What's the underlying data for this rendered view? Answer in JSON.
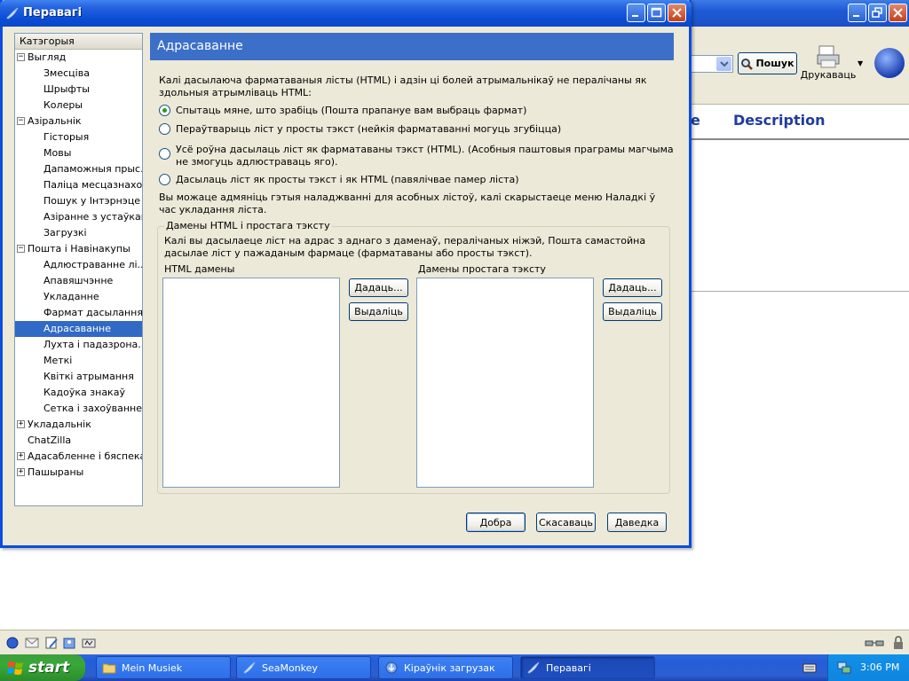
{
  "background_window": {
    "search_button": "Пошук",
    "print_label": "Друкаваць",
    "column_partial": "e",
    "column_description": "Description"
  },
  "dialog": {
    "title": "Перавагі",
    "category_header": "Катэгорыя",
    "tree": [
      {
        "label": "Выгляд",
        "level": 0,
        "twisty": "−"
      },
      {
        "label": "Змесціва",
        "level": 1
      },
      {
        "label": "Шрыфты",
        "level": 1
      },
      {
        "label": "Колеры",
        "level": 1
      },
      {
        "label": "Азіральнік",
        "level": 0,
        "twisty": "−"
      },
      {
        "label": "Гісторыя",
        "level": 1
      },
      {
        "label": "Мовы",
        "level": 1
      },
      {
        "label": "Дапаможныя прыс...",
        "level": 1
      },
      {
        "label": "Паліца месцазнахо...",
        "level": 1
      },
      {
        "label": "Пошук у Інтэрнэце",
        "level": 1
      },
      {
        "label": "Азіранне з устаўкамі",
        "level": 1
      },
      {
        "label": "Загрузкі",
        "level": 1
      },
      {
        "label": "Пошта і Навінакупы",
        "level": 0,
        "twisty": "−"
      },
      {
        "label": "Адлюстраванне лі...",
        "level": 1
      },
      {
        "label": "Апавяшчэнне",
        "level": 1
      },
      {
        "label": "Укладанне",
        "level": 1
      },
      {
        "label": "Фармат дасылання",
        "level": 1
      },
      {
        "label": "Адрасаванне",
        "level": 1,
        "selected": true
      },
      {
        "label": "Луxта і падазрона...",
        "level": 1
      },
      {
        "label": "Меткі",
        "level": 1
      },
      {
        "label": "Квіткі атрымання",
        "level": 1
      },
      {
        "label": "Кадоўка знакаў",
        "level": 1
      },
      {
        "label": "Сетка і захоўванне",
        "level": 1
      },
      {
        "label": "Укладальнік",
        "level": 0,
        "twisty": "+"
      },
      {
        "label": "ChatZilla",
        "level": 0
      },
      {
        "label": "Адасабленне і бяспека",
        "level": 0,
        "twisty": "+"
      },
      {
        "label": "Пашыраны",
        "level": 0,
        "twisty": "+"
      }
    ],
    "pane_title": "Адрасаванне",
    "intro": "Калі дасылаюча фарматаваныя лісты (HTML) і адзін ці болей атрымальнікаў не пералічаны як здольныя атрымліваць HTML:",
    "radios": [
      {
        "label": "Спытаць мяне, што зрабіць (Пошта прапануе вам выбраць фармат)",
        "checked": true
      },
      {
        "label": "Пераўтварыць ліст у просты тэкст (нейкія фарматаванні могуць згубіцца)",
        "checked": false
      },
      {
        "label": "Усё роўна дасылаць ліст як фарматаваны тэкст (HTML). (Асобныя паштовыя праграмы магчыма не змогуць адлюстраваць яго).",
        "checked": false
      },
      {
        "label": "Дасылаць ліст як просты тэкст і як HTML (павялічвае памер ліста)",
        "checked": false
      }
    ],
    "note": "Вы можаце адмяніць гэтыя наладжванні для асобных лістоў, калі скарыстаеце меню Наладкі ў час укладання ліста.",
    "group_legend": "Дамены HTML і простага тэксту",
    "group_text": "Калі вы дасылаеце ліст на адрас з аднаго з даменаў, пералічаных ніжэй, Пошта самастойна дасылае ліст у пажаданым фармаце (фарматаваны або просты тэкст).",
    "html_label": "HTML дамены",
    "plain_label": "Дамены простага тэксту",
    "add_button": "Дадаць...",
    "remove_button": "Выдаліць",
    "ok_button": "Добра",
    "cancel_button": "Скасаваць",
    "help_button": "Даведка"
  },
  "taskbar": {
    "start": "start",
    "tasks": [
      "Mein Musiek",
      "SeaMonkey",
      "Кіраўнік загрузак",
      "Перавагі"
    ],
    "time": "3:06 PM"
  }
}
